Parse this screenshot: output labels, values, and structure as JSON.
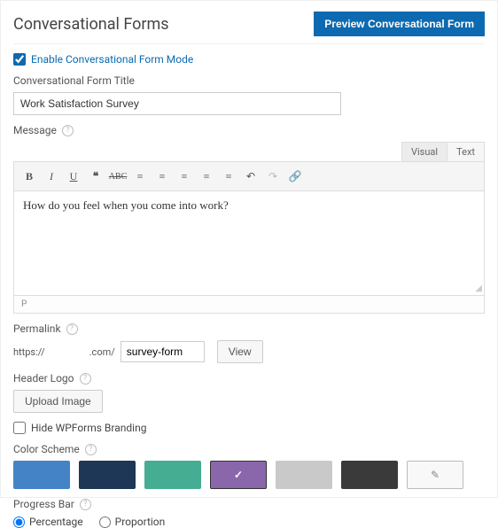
{
  "header": {
    "title": "Conversational Forms",
    "preview_btn": "Preview Conversational Form"
  },
  "enable": {
    "label": "Enable Conversational Form Mode",
    "checked": true
  },
  "title_field": {
    "label": "Conversational Form Title",
    "value": "Work Satisfaction Survey"
  },
  "message": {
    "label": "Message",
    "tabs": {
      "visual": "Visual",
      "text": "Text"
    },
    "content": "How do you feel when you come into work?",
    "path": "P"
  },
  "permalink": {
    "label": "Permalink",
    "prefix": "https://",
    "domain_suffix": ".com/",
    "slug": "survey-form",
    "view_btn": "View"
  },
  "header_logo": {
    "label": "Header Logo",
    "upload_btn": "Upload Image"
  },
  "branding": {
    "label": "Hide WPForms Branding",
    "checked": false
  },
  "color_scheme": {
    "label": "Color Scheme",
    "swatches": [
      "#4483c6",
      "#1e3756",
      "#45ad92",
      "#8a67ab",
      "#c9c9c9",
      "#3a3a3a"
    ],
    "selected_index": 3,
    "check_glyph": "✓",
    "picker_glyph": "✎"
  },
  "progress_bar": {
    "label": "Progress Bar",
    "options": {
      "percentage": "Percentage",
      "proportion": "Proportion"
    },
    "selected": "percentage"
  }
}
